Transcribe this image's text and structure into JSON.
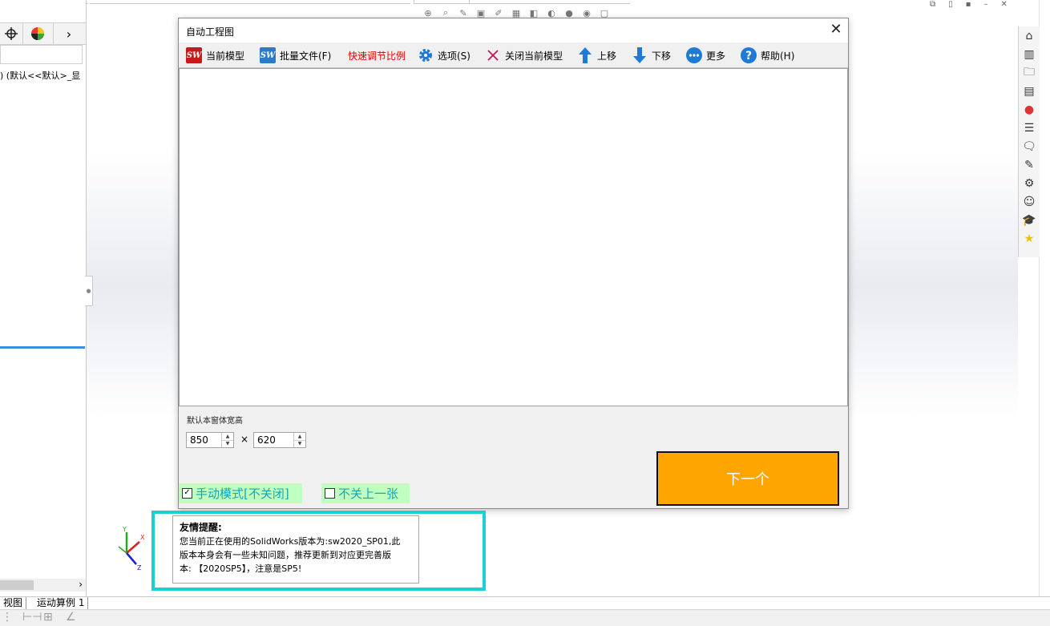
{
  "dialog": {
    "title": "自动工程图",
    "close_glyph": "✕",
    "toolbar": {
      "current_model": "当前模型",
      "batch_files": "批量文件(F)",
      "quick_scale": "快速调节比例",
      "options": "选项(S)",
      "close_current": "关闭当前模型",
      "move_up": "上移",
      "move_down": "下移",
      "more": "更多",
      "help": "帮助(H)"
    },
    "size_label": "默认本窗体宽高",
    "width_value": "850",
    "height_value": "620",
    "times_sign": "×",
    "next_button": "下一个",
    "manual_mode": "手动模式[不关闭]",
    "keep_previous": "不关上一张",
    "manual_mode_checked": true,
    "keep_previous_checked": false,
    "sw_logo_text": "SW",
    "colors": {
      "next": "#ffa500",
      "check_bg": "#bfffbf",
      "check_text": "#19a6b3",
      "quick_scale": "#e00000",
      "notice_frame": "#1ccfd6"
    }
  },
  "notice": {
    "title": "友情提醒:",
    "line1": "您当前正在使用的SolidWorks版本为:sw2020_SP01,此",
    "line2": "版本本身会有一些未知问题，推荐更新到对应更完善版",
    "line3": "本: 【2020SP5】，注意是SP5!"
  },
  "background": {
    "tree_text": ") (默认<<默认>_显",
    "tab_view": "视图",
    "tab_motion": "运动算例 1",
    "scroll_arrow": "›",
    "tab_arrow": "›",
    "triad_labels": {
      "x": "X",
      "y": "Y",
      "z": "Z"
    }
  }
}
